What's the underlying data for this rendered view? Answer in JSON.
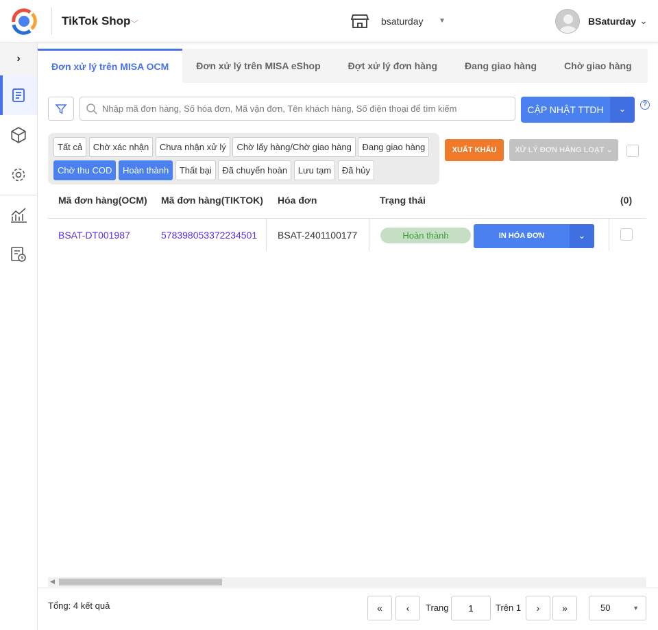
{
  "header": {
    "app": "TikTok Shop",
    "store": "bsaturday",
    "user": "BSaturday"
  },
  "sidebar": {
    "items": [
      "orders-icon",
      "box-icon",
      "gear-icon",
      "chart-icon",
      "report-icon"
    ]
  },
  "tabs": [
    {
      "label": "Đơn xử lý trên MISA OCM",
      "active": true
    },
    {
      "label": "Đơn xử lý trên MISA eShop"
    },
    {
      "label": "Đợt xử lý đơn hàng"
    },
    {
      "label": "Đang giao hàng"
    },
    {
      "label": "Chờ giao hàng"
    }
  ],
  "search": {
    "placeholder": "Nhập mã đơn hàng, Số hóa đơn, Mã vận đơn, Tên khách hàng, Số điện thoại để tìm kiếm",
    "value": ""
  },
  "update_button": "CẬP NHẬT TTDH",
  "help": "?",
  "chips": [
    {
      "label": "Tất cả"
    },
    {
      "label": "Chờ xác nhận"
    },
    {
      "label": "Chưa nhận xử lý"
    },
    {
      "label": "Chờ lấy hàng/Chờ giao hàng"
    },
    {
      "label": "Đang giao hàng"
    },
    {
      "label": "Chờ thu COD",
      "on": true
    },
    {
      "label": "Hoàn thành",
      "on": true
    },
    {
      "label": "Thất bại"
    },
    {
      "label": "Đã chuyển hoàn"
    },
    {
      "label": "Lưu tạm"
    },
    {
      "label": "Đã hủy"
    }
  ],
  "export_button": "XUẤT KHẨU",
  "bulk_button": "XỬ LÝ ĐƠN HÀNG LOẠT",
  "table": {
    "columns": [
      "Mã đơn hàng(OCM)",
      "Mã đơn hàng(TIKTOK)",
      "Hóa đơn",
      "Trạng thái",
      "(0)"
    ],
    "rows": [
      {
        "ocm": "BSAT-DT001987",
        "tiktok": "578398053372234501",
        "invoice": "BSAT-2401100177",
        "status": "Hoàn thành",
        "action": "IN HÓA ĐƠN"
      }
    ]
  },
  "footer": {
    "total": "Tổng: 4 kết quả",
    "page_label": "Trang",
    "page": "1",
    "of": "Trên 1",
    "page_size": "50"
  }
}
